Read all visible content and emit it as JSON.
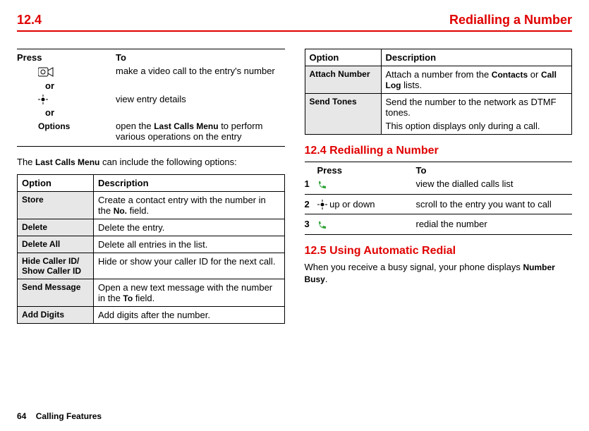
{
  "header": {
    "section_number": "12.4",
    "section_title": "Redialling a Number"
  },
  "left": {
    "press_label": "Press",
    "to_label": "To",
    "rows": [
      {
        "action_icon": "video-call-icon",
        "desc": "make a video call to the entry's number"
      },
      {
        "or": "or"
      },
      {
        "action_icon": "nav-dot-icon",
        "desc": "view entry details"
      },
      {
        "or": "or"
      },
      {
        "action_text": "Options",
        "desc_prefix": "open the ",
        "desc_bold": "Last Calls Menu",
        "desc_suffix": " to perform various operations on the entry"
      }
    ],
    "intro_prefix": "The ",
    "intro_bold": "Last Calls Menu",
    "intro_suffix": " can include the following options:",
    "table_headers": {
      "option": "Option",
      "description": "Description"
    },
    "options": [
      {
        "label": "Store",
        "desc_prefix": "Create a contact entry with the number in the ",
        "desc_bold": "No.",
        "desc_suffix": " field."
      },
      {
        "label": "Delete",
        "desc": "Delete the entry."
      },
      {
        "label": "Delete All",
        "desc": "Delete all entries in the list."
      },
      {
        "label": "Hide Caller ID/\nShow Caller ID",
        "desc": "Hide or show your caller ID for the next call."
      },
      {
        "label": "Send Message",
        "desc_prefix": "Open a new text message with the number in the ",
        "desc_bold": "To",
        "desc_suffix": " field."
      },
      {
        "label": "Add Digits",
        "desc": "Add digits after the number."
      }
    ]
  },
  "right": {
    "table_headers": {
      "option": "Option",
      "description": "Description"
    },
    "options": [
      {
        "label": "Attach Number",
        "desc_prefix": "Attach a number from the ",
        "desc_bold1": "Contacts",
        "desc_mid": " or ",
        "desc_bold2": "Call Log",
        "desc_suffix": " lists."
      },
      {
        "label": "Send Tones",
        "desc_line1": "Send the number to the network as DTMF tones.",
        "desc_line2": "This option displays only during a call."
      }
    ],
    "sec124": {
      "title": "12.4 Redialling a Number",
      "press_label": "Press",
      "to_label": "To",
      "steps": [
        {
          "num": "1",
          "action_icon": "call-icon",
          "desc": "view the dialled calls list"
        },
        {
          "num": "2",
          "action_icon": "nav-dot-icon",
          "action_text": " up or down",
          "desc": "scroll to the entry you want to call"
        },
        {
          "num": "3",
          "action_icon": "call-icon",
          "desc": "redial the number"
        }
      ]
    },
    "sec125": {
      "title": "12.5 Using Automatic Redial",
      "body_prefix": "When you receive a busy signal, your phone displays ",
      "body_bold": "Number Busy",
      "body_suffix": "."
    }
  },
  "footer": {
    "page": "64",
    "chapter": "Calling Features"
  }
}
